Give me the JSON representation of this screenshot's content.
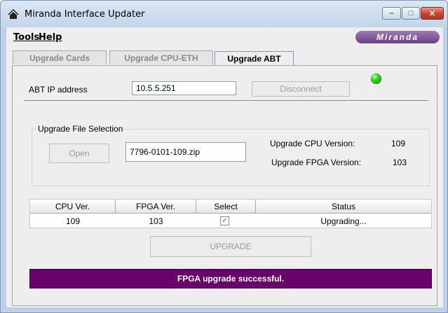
{
  "window": {
    "title": "Miranda Interface Updater",
    "icon": "miranda-app-icon",
    "controls": {
      "minimize": "–",
      "maximize": "□",
      "close": "✕"
    }
  },
  "menu": {
    "tools": "Tools",
    "help": "Help"
  },
  "brand": {
    "logo_text": "Miranda",
    "logo_color": "#6b4184"
  },
  "tabs": [
    {
      "label": "Upgrade Cards",
      "active": false
    },
    {
      "label": "Upgrade CPU-ETH",
      "active": false
    },
    {
      "label": "Upgrade ABT",
      "active": true
    }
  ],
  "connection": {
    "ip_label": "ABT IP address",
    "ip_value": "10.5.5.251",
    "disconnect_label": "Disconnect",
    "status_led_color": "#38d028"
  },
  "file_selection": {
    "group_title": "Upgrade File Selection",
    "open_label": "Open",
    "file_name": "7796-0101-109.zip",
    "cpu_version_label": "Upgrade CPU Version:",
    "cpu_version_value": "109",
    "fpga_version_label": "Upgrade FPGA Version:",
    "fpga_version_value": "103"
  },
  "table": {
    "columns": [
      "CPU Ver.",
      "FPGA Ver.",
      "Select",
      "Status"
    ],
    "rows": [
      {
        "cpu": "109",
        "fpga": "103",
        "selected": true,
        "status": "Upgrading..."
      }
    ]
  },
  "upgrade_label": "UPGRADE",
  "status_message": "FPGA upgrade successful.",
  "colors": {
    "status_bar_bg": "#6a006a",
    "accent": "#6f8fb8"
  }
}
